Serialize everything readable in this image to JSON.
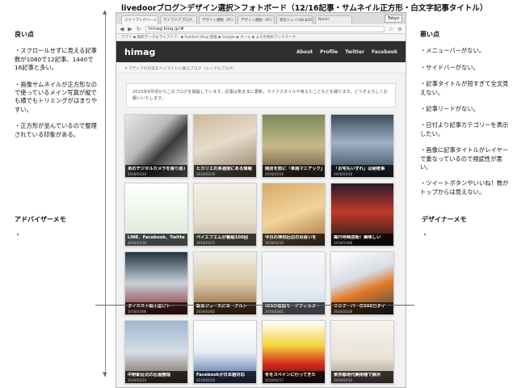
{
  "page_title": "livedoorブログ＞デザイン選択＞フォトボード（12/16記事・サムネイル正方形・白文字記事タイトル）",
  "good": {
    "heading": "良い点",
    "items": [
      "・スクロールせずに見える記事数が1080で12記事、1440で16記事と多い。",
      "・画像サムネイルが正方形なので使っているメイン写真が縦でも横でもトリミングがはまりやすい。",
      "・正方形が並んでいるので整理されている印象がある。"
    ]
  },
  "bad": {
    "heading": "悪い点",
    "items": [
      "・メニューバーがない。",
      "・サイドバーがない。",
      "・記事タイトルが短すぎて全文見えない。",
      "・記事リードがない。",
      "・日付より記事カテゴリーを表示したい。",
      "・画像に記事タイトルがレイヤーで重なっているので視認性が悪い。",
      "・ツイートボタンやいいね！数がトップからは見えない。"
    ]
  },
  "advisor_memo": {
    "label": "アドバイザーメモ",
    "content": "・"
  },
  "designer_memo": {
    "label": "デザイナーメモ",
    "content": "・"
  },
  "browser": {
    "tabs": [
      "スクリプトがベージ..",
      "ライブドアブログ..",
      "デザイン選択（PC）",
      "デザイン選択（PC）",
      "受信トレイ(48,820)",
      "Naver"
    ],
    "user_button": "Tokyo",
    "url": "himag.blog.jp/#",
    "bookmarks": "アプリ  ◆ 最新データ＆ライブドア..  ◆ livedoor Blog 管理  ◆ Google  ◆ ホーム  ◆ よその他のブックマーク"
  },
  "site": {
    "logo": "himag",
    "nav": [
      "About",
      "Profile",
      "Twitter",
      "Facebook"
    ],
    "tagline": "ヒマディアの日常をハイライトに綴るブログ（ミニマルブログ）",
    "notice": "2015年4月頃からこのブログを開設しています。記事は気ままに更新。ライフスタイルや考えたことなどを綴ります。どうぞよろしくお願いいたします。"
  },
  "posts": [
    {
      "title": "あのデジタルカメラを振り返る",
      "date": "2016/03/20"
    },
    {
      "title": "ヒカリエの多週間にある情報",
      "date": "2016/03/19"
    },
    {
      "title": "閉店を前に「単独マニアック」",
      "date": "2016/03/19"
    },
    {
      "title": "「お宅もいずれ」は秘密事",
      "date": "2016/03/18"
    },
    {
      "title": "LINE、Facebook、Twitter",
      "date": "2016/03/16"
    },
    {
      "title": "ベイエフエムが番組100回",
      "date": "2016/03/15"
    },
    {
      "title": "今日の神田近辺の出会いを",
      "date": "2016/03/10"
    },
    {
      "title": "高円寺商店街！美味しい",
      "date": "2016/03/08"
    },
    {
      "title": "ダイカスト製小型ピトー",
      "date": "2016/03/06"
    },
    {
      "title": "朝食ジュースにヨーグルト",
      "date": "2016/03/02"
    },
    {
      "title": "iOSの夜間モードフィルター",
      "date": "2016/03/01"
    },
    {
      "title": "ミニクーパーの500万ダイ",
      "date": "2016/02/28"
    },
    {
      "title": "中野駅近辺の区画整理",
      "date": "2016/02/24"
    },
    {
      "title": "Facebookが日本語対応",
      "date": "2016/02/20"
    },
    {
      "title": "冬をスペインに行ってきた",
      "date": "2016/02/17"
    },
    {
      "title": "東京都現代美術館で展示",
      "date": "2016/02/14"
    }
  ],
  "colors": {
    "header_bg": "#2f2f2f",
    "caption_bg": "#000000"
  }
}
